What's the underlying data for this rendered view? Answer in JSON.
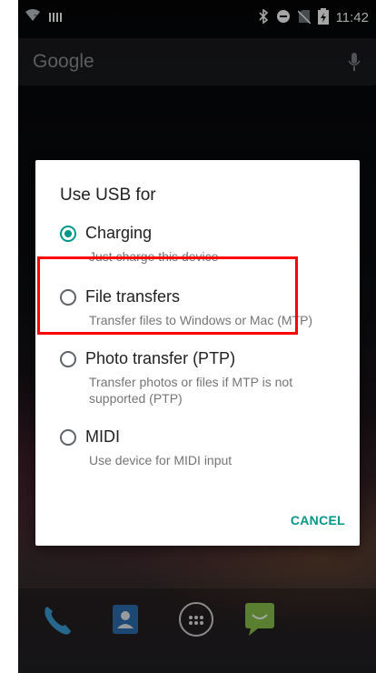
{
  "status_bar": {
    "time": "11:42",
    "icons": [
      "wifi-icon",
      "signal-icon",
      "bluetooth-icon",
      "do-not-disturb-icon",
      "no-sim-icon",
      "battery-charging-icon"
    ]
  },
  "search": {
    "label": "Google"
  },
  "dialog": {
    "title": "Use USB for",
    "options": [
      {
        "label": "Charging",
        "sublabel": "Just charge this device",
        "checked": true
      },
      {
        "label": "File transfers",
        "sublabel": "Transfer files to Windows or Mac (MTP)",
        "checked": false
      },
      {
        "label": "Photo transfer (PTP)",
        "sublabel": "Transfer photos or files if MTP is not supported (PTP)",
        "checked": false
      },
      {
        "label": "MIDI",
        "sublabel": "Use device for MIDI input",
        "checked": false
      }
    ],
    "cancel_label": "CANCEL"
  },
  "dock": {
    "icons": [
      "phone-icon",
      "contacts-icon",
      "app-drawer-icon",
      "messaging-icon"
    ]
  },
  "colors": {
    "accent": "#009688",
    "highlight": "#ff0000"
  }
}
